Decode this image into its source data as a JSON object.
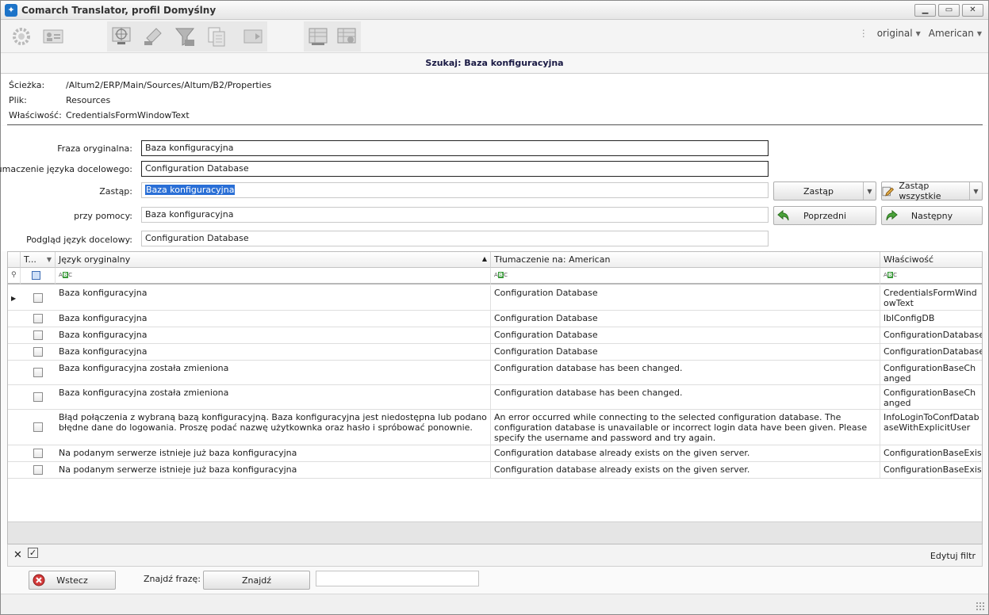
{
  "window": {
    "title": "Comarch Translator, profil Domyślny"
  },
  "toolbar": {
    "original_label": "original",
    "language_label": "American"
  },
  "header": {
    "title": "Szukaj: Baza konfiguracyjna"
  },
  "info": {
    "path_label": "Ścieżka:",
    "path_value": "/Altum2/ERP/Main/Sources/Altum/B2/Properties",
    "file_label": "Plik:",
    "file_value": "Resources",
    "property_label": "Właściwość:",
    "property_value": "CredentialsFormWindowText"
  },
  "form": {
    "original_label": "Fraza oryginalna:",
    "original_value": "Baza konfiguracyjna",
    "translation_label": "Tłumaczenie języka docelowego:",
    "translation_value": "Configuration Database",
    "replace_label": "Zastąp:",
    "replace_value": "Baza konfiguracyjna",
    "with_label": "przy pomocy:",
    "with_value": "Baza konfiguracyjna",
    "preview_label": "Podgląd język docelowy:",
    "preview_value": "Configuration Database",
    "replace_button": "Zastąp",
    "replace_all_button": "Zastąp wszystkie",
    "prev_button": "Poprzedni",
    "next_button": "Następny"
  },
  "grid": {
    "columns": [
      "T...",
      "Język oryginalny",
      "Tłumaczenie na: American",
      "Właściwość"
    ],
    "rows": [
      {
        "original": "Baza konfiguracyjna",
        "translation": "Configuration Database",
        "property": "CredentialsFormWindowText"
      },
      {
        "original": "Baza konfiguracyjna",
        "translation": "Configuration Database",
        "property": "lblConfigDB"
      },
      {
        "original": "Baza konfiguracyjna",
        "translation": "Configuration Database",
        "property": "ConfigurationDatabase"
      },
      {
        "original": "Baza konfiguracyjna",
        "translation": "Configuration Database",
        "property": "ConfigurationDatabase"
      },
      {
        "original": "Baza konfiguracyjna została zmieniona",
        "translation": "Configuration database has been changed.",
        "property": "ConfigurationBaseChanged"
      },
      {
        "original": "Baza konfiguracyjna została zmieniona",
        "translation": "Configuration database has been changed.",
        "property": "ConfigurationBaseChanged"
      },
      {
        "original": "Błąd połączenia z wybraną bazą konfiguracyjną. Baza konfiguracyjna jest niedostępna lub podano błędne dane do logowania. Proszę podać nazwę użytkownka oraz hasło i spróbować ponownie.",
        "translation": "An error occurred while connecting to the selected configuration database. The configuration database is unavailable or incorrect login data have been given. Please specify the username and password and try again.",
        "property": "InfoLoginToConfDatabaseWithExplicitUser"
      },
      {
        "original": "Na podanym serwerze istnieje już baza konfiguracyjna",
        "translation": "Configuration database already exists on the given server.",
        "property": "ConfigurationBaseExists"
      },
      {
        "original": "Na podanym serwerze istnieje już baza konfiguracyjna",
        "translation": "Configuration database already exists on the given server.",
        "property": "ConfigurationBaseExists"
      }
    ]
  },
  "filterbar": {
    "edit_filter": "Edytuj filtr"
  },
  "bottom": {
    "back_button": "Wstecz",
    "find_label": "Znajdź frazę:",
    "find_button": "Znajdź",
    "find_value": ""
  }
}
